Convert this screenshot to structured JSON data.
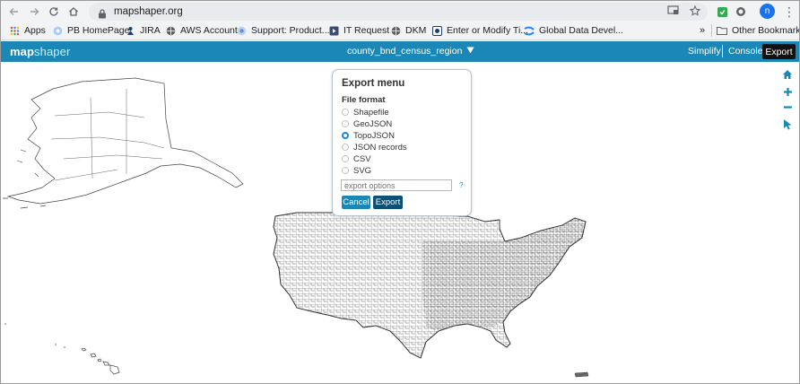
{
  "browser": {
    "url": "mapshaper.org",
    "profile_initial": "n"
  },
  "bookmarks": [
    {
      "label": "Apps",
      "icon": "apps-grid-icon"
    },
    {
      "label": "PB HomePage",
      "icon": "globe-icon"
    },
    {
      "label": "JIRA",
      "icon": "jira-icon"
    },
    {
      "label": "AWS Account",
      "icon": "globe-icon"
    },
    {
      "label": "Support: Product...",
      "icon": "support-icon"
    },
    {
      "label": "IT Request",
      "icon": "it-request-icon"
    },
    {
      "label": "DKM",
      "icon": "globe-icon"
    },
    {
      "label": "Enter or Modify Ti...",
      "icon": "timesheet-icon"
    },
    {
      "label": "Global Data Devel...",
      "icon": "confluence-icon"
    }
  ],
  "bookmarks_overflow": "»",
  "other_bookmarks": "Other Bookmarks",
  "app": {
    "logo_part1": "map",
    "logo_part2": "shaper",
    "layer_name": "county_bnd_census_region",
    "simplify": "Simplify",
    "console": "Console",
    "export": "Export"
  },
  "export_menu": {
    "title": "Export menu",
    "section": "File format",
    "formats": [
      {
        "label": "Shapefile",
        "selected": false
      },
      {
        "label": "GeoJSON",
        "selected": false
      },
      {
        "label": "TopoJSON",
        "selected": true
      },
      {
        "label": "JSON records",
        "selected": false
      },
      {
        "label": "CSV",
        "selected": false
      },
      {
        "label": "SVG",
        "selected": false
      }
    ],
    "options_placeholder": "export options",
    "help": "?",
    "cancel": "Cancel",
    "export": "Export"
  },
  "colors": {
    "header": "#1a87b6",
    "accent": "#1a87e0"
  }
}
